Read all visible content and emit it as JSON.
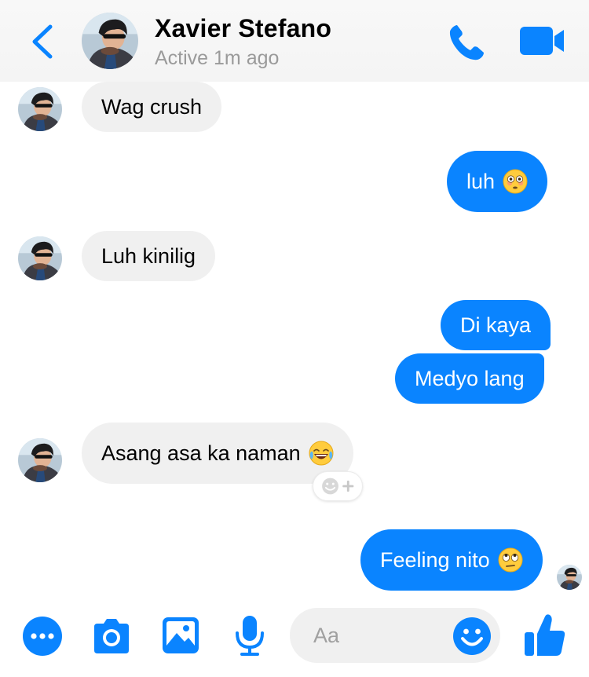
{
  "header": {
    "name": "Xavier Stefano",
    "status": "Active 1m ago",
    "back_icon": "chevron-left-icon",
    "call_icon": "phone-icon",
    "video_icon": "video-camera-icon"
  },
  "messages": [
    {
      "from": "them",
      "text": "Wag crush"
    },
    {
      "from": "me",
      "text": "luh",
      "emoji": "flushed-face"
    },
    {
      "from": "them",
      "text": "Luh kinilig"
    },
    {
      "from": "me",
      "text": "Di kaya"
    },
    {
      "from": "me",
      "text": "Medyo lang"
    },
    {
      "from": "them",
      "text": "Asang asa ka naman",
      "emoji": "tears-of-joy-face"
    },
    {
      "from": "me",
      "text": "Feeling nito",
      "emoji": "eye-roll-face"
    }
  ],
  "composer": {
    "placeholder": "Aa",
    "more_icon": "more-dots-icon",
    "camera_icon": "camera-icon",
    "gallery_icon": "image-icon",
    "mic_icon": "microphone-icon",
    "emoji_icon": "smiley-icon",
    "like_icon": "thumbs-up-icon"
  },
  "colors": {
    "accent": "#0a84ff",
    "incoming_bubble": "#f0f0f0",
    "status_text": "#9a9a9a"
  }
}
